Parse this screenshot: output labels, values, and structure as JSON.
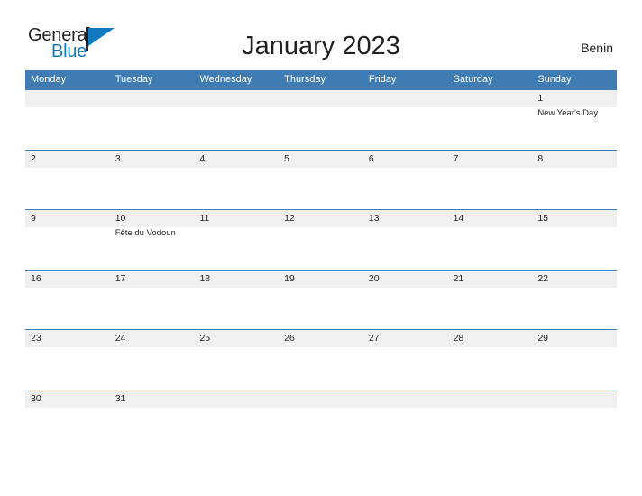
{
  "brand": {
    "name_part1": "General",
    "name_part2": "Blue",
    "flag_icon": "flag-triangle-icon",
    "colors": {
      "text": "#231f20",
      "blue": "#1179bf"
    }
  },
  "header": {
    "title": "January 2023",
    "region": "Benin"
  },
  "theme": {
    "header_blue": "#3f7cb4",
    "band_gray": "#f0f0f0",
    "page_background": "#ffffff",
    "text": "#231f20"
  },
  "calendar": {
    "weekday_headers": [
      "Monday",
      "Tuesday",
      "Wednesday",
      "Thursday",
      "Friday",
      "Saturday",
      "Sunday"
    ],
    "weeks": [
      {
        "days": [
          {
            "number": "",
            "event": ""
          },
          {
            "number": "",
            "event": ""
          },
          {
            "number": "",
            "event": ""
          },
          {
            "number": "",
            "event": ""
          },
          {
            "number": "",
            "event": ""
          },
          {
            "number": "",
            "event": ""
          },
          {
            "number": "1",
            "event": "New Year's Day"
          }
        ]
      },
      {
        "days": [
          {
            "number": "2",
            "event": ""
          },
          {
            "number": "3",
            "event": ""
          },
          {
            "number": "4",
            "event": ""
          },
          {
            "number": "5",
            "event": ""
          },
          {
            "number": "6",
            "event": ""
          },
          {
            "number": "7",
            "event": ""
          },
          {
            "number": "8",
            "event": ""
          }
        ]
      },
      {
        "days": [
          {
            "number": "9",
            "event": ""
          },
          {
            "number": "10",
            "event": "Fête du Vodoun"
          },
          {
            "number": "11",
            "event": ""
          },
          {
            "number": "12",
            "event": ""
          },
          {
            "number": "13",
            "event": ""
          },
          {
            "number": "14",
            "event": ""
          },
          {
            "number": "15",
            "event": ""
          }
        ]
      },
      {
        "days": [
          {
            "number": "16",
            "event": ""
          },
          {
            "number": "17",
            "event": ""
          },
          {
            "number": "18",
            "event": ""
          },
          {
            "number": "19",
            "event": ""
          },
          {
            "number": "20",
            "event": ""
          },
          {
            "number": "21",
            "event": ""
          },
          {
            "number": "22",
            "event": ""
          }
        ]
      },
      {
        "days": [
          {
            "number": "23",
            "event": ""
          },
          {
            "number": "24",
            "event": ""
          },
          {
            "number": "25",
            "event": ""
          },
          {
            "number": "26",
            "event": ""
          },
          {
            "number": "27",
            "event": ""
          },
          {
            "number": "28",
            "event": ""
          },
          {
            "number": "29",
            "event": ""
          }
        ]
      },
      {
        "days": [
          {
            "number": "30",
            "event": ""
          },
          {
            "number": "31",
            "event": ""
          },
          {
            "number": "",
            "event": ""
          },
          {
            "number": "",
            "event": ""
          },
          {
            "number": "",
            "event": ""
          },
          {
            "number": "",
            "event": ""
          },
          {
            "number": "",
            "event": ""
          }
        ]
      }
    ]
  }
}
